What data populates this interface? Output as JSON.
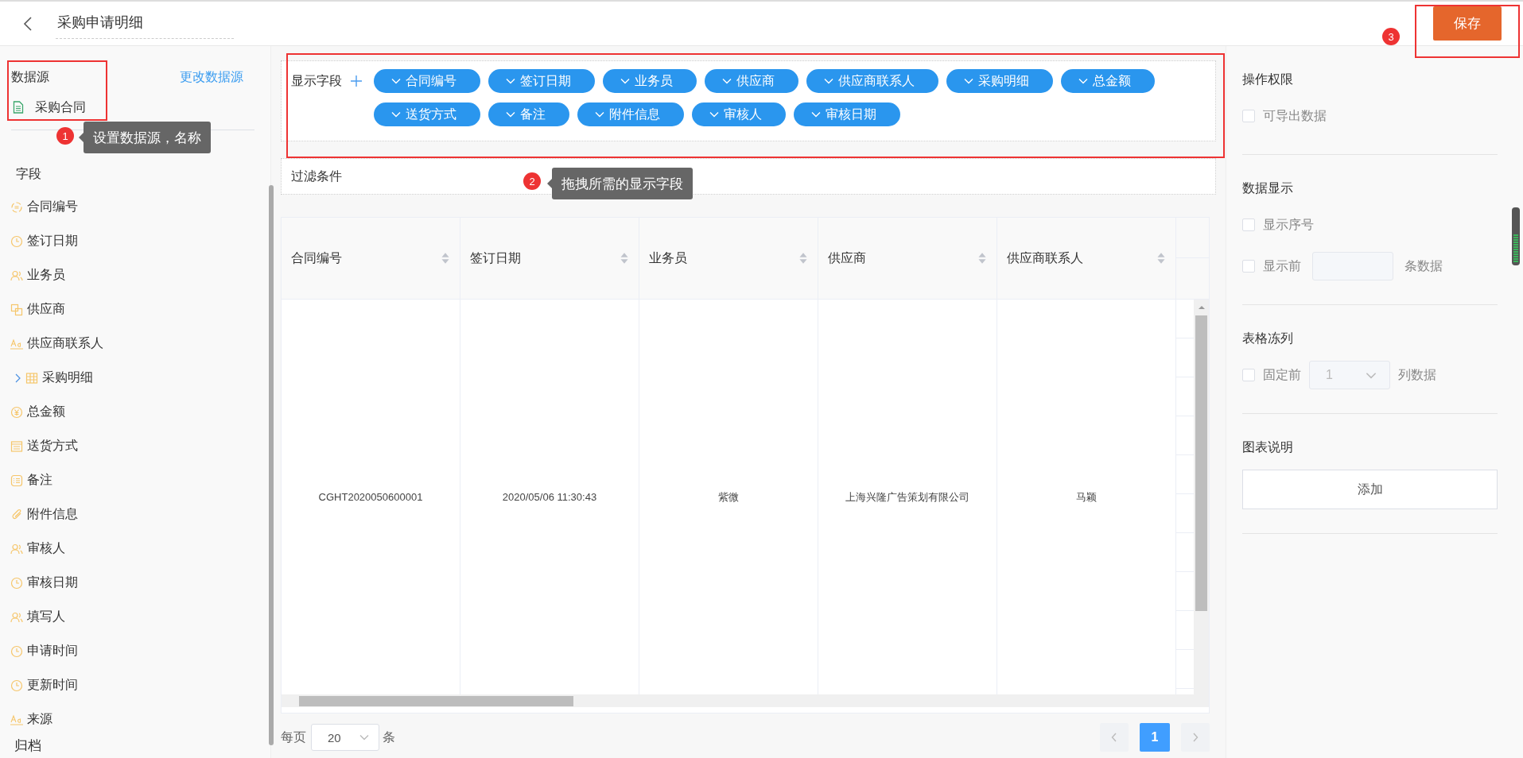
{
  "header": {
    "title": "采购申请明细",
    "save_button": "保存"
  },
  "data_source": {
    "label": "数据源",
    "change_link": "更改数据源",
    "source_name": "采购合同"
  },
  "fields": {
    "heading": "字段",
    "items": [
      {
        "label": "合同编号",
        "kind": "serial"
      },
      {
        "label": "签订日期",
        "kind": "date"
      },
      {
        "label": "业务员",
        "kind": "user"
      },
      {
        "label": "供应商",
        "kind": "relation"
      },
      {
        "label": "供应商联系人",
        "kind": "text"
      },
      {
        "label": "采购明细",
        "kind": "table",
        "expanded": false
      },
      {
        "label": "总金额",
        "kind": "money"
      },
      {
        "label": "送货方式",
        "kind": "select"
      },
      {
        "label": "备注",
        "kind": "note"
      },
      {
        "label": "附件信息",
        "kind": "attachment"
      },
      {
        "label": "审核人",
        "kind": "user"
      },
      {
        "label": "审核日期",
        "kind": "date"
      },
      {
        "label": "填写人",
        "kind": "user"
      },
      {
        "label": "申请时间",
        "kind": "date"
      },
      {
        "label": "更新时间",
        "kind": "date"
      },
      {
        "label": "来源",
        "kind": "text"
      }
    ],
    "group_heading": "归档"
  },
  "display_fields": {
    "label": "显示字段",
    "chips": [
      "合同编号",
      "签订日期",
      "业务员",
      "供应商",
      "供应商联系人",
      "采购明细",
      "总金额",
      "送货方式",
      "备注",
      "附件信息",
      "审核人",
      "审核日期"
    ]
  },
  "filter": {
    "label": "过滤条件"
  },
  "table": {
    "columns": [
      "合同编号",
      "签订日期",
      "业务员",
      "供应商",
      "供应商联系人"
    ],
    "rows": [
      {
        "cells": [
          "CGHT2020050600001",
          "2020/05/06 11:30:43",
          "紫微",
          "上海兴隆广告策划有限公司",
          "马颖"
        ]
      }
    ]
  },
  "pagination": {
    "per_page_label": "每页",
    "page_size": "20",
    "unit": "条",
    "pages": [
      {
        "label": "1",
        "selected": true
      }
    ]
  },
  "settings": [
    {
      "title": "操作权限",
      "options": [
        {
          "kind": "checkbox",
          "label": "可导出数据",
          "checked": false
        }
      ]
    },
    {
      "title": "数据显示",
      "options": [
        {
          "kind": "checkbox",
          "label": "显示序号",
          "checked": false
        },
        {
          "kind": "input",
          "label": "显示前",
          "suffix": "条数据",
          "checked": false
        }
      ]
    },
    {
      "title": "表格冻列",
      "options": [
        {
          "kind": "select",
          "label": "固定前",
          "value": "1",
          "suffix": "列数据",
          "checked": false
        }
      ]
    },
    {
      "title": "图表说明",
      "options": [
        {
          "kind": "button",
          "label": "添加"
        }
      ]
    }
  ],
  "annotations": [
    {
      "number": "1",
      "text": "设置数据源，名称"
    },
    {
      "number": "2",
      "text": "拖拽所需的显示字段"
    },
    {
      "number": "3"
    }
  ]
}
